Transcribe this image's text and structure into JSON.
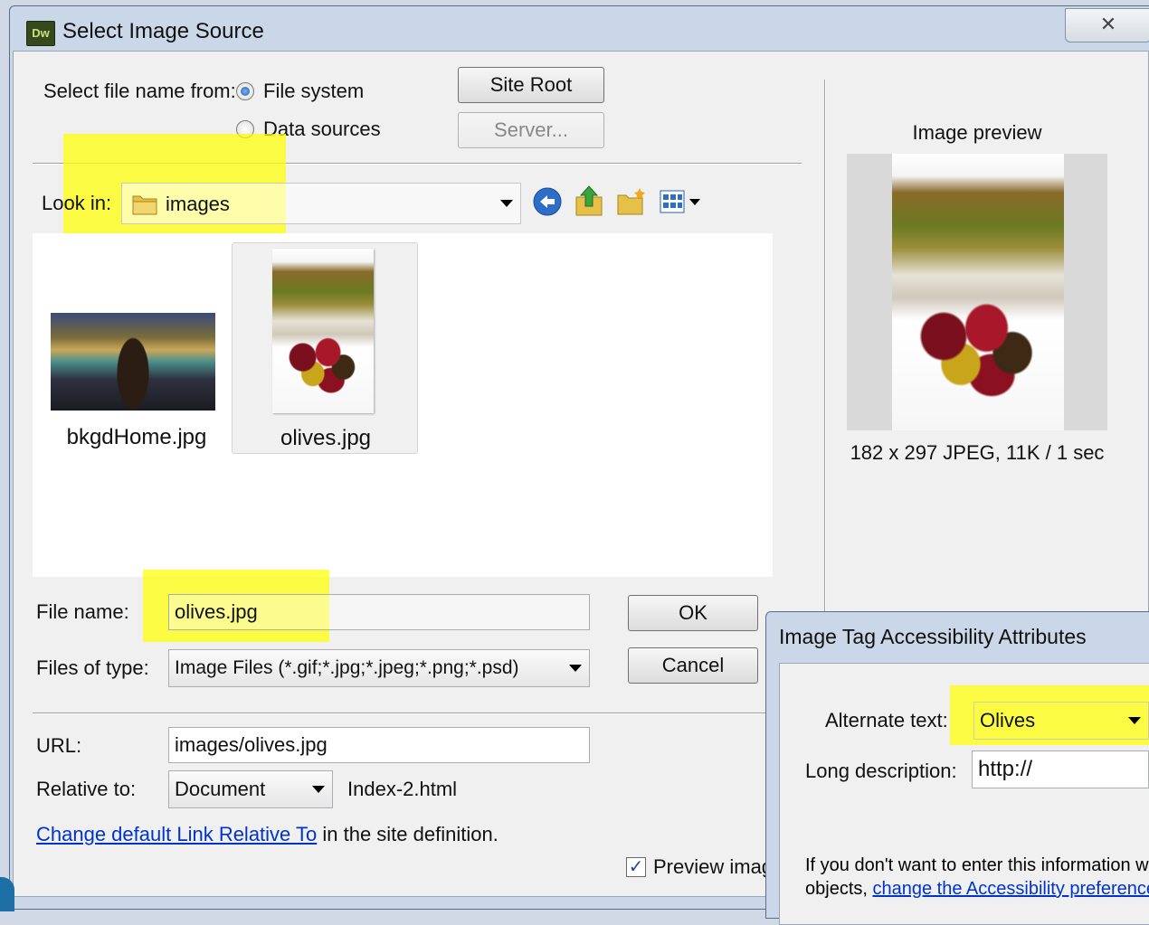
{
  "main_dialog": {
    "title": "Select Image Source",
    "app_icon_text": "Dw",
    "close_glyph": "✕",
    "select_from_label": "Select file name from:",
    "radio_file_system": "File system",
    "radio_data_sources": "Data sources",
    "site_root_button": "Site Root",
    "server_button": "Server...",
    "look_in_label": "Look in:",
    "look_in_value": "images",
    "files": [
      {
        "name": "bkgdHome.jpg",
        "selected": false
      },
      {
        "name": "olives.jpg",
        "selected": true
      }
    ],
    "file_name_label": "File name:",
    "file_name_value": "olives.jpg",
    "files_of_type_label": "Files of type:",
    "files_of_type_value": "Image Files (*.gif;*.jpg;*.jpeg;*.png;*.psd)",
    "ok_button": "OK",
    "cancel_button": "Cancel",
    "url_label": "URL:",
    "url_value": "images/olives.jpg",
    "relative_to_label": "Relative to:",
    "relative_to_value": "Document",
    "relative_file": "Index-2.html",
    "change_link_text": "Change default Link Relative To",
    "change_link_suffix": " in the site definition.",
    "preview_checkbox_label": "Preview images",
    "image_preview_label": "Image preview",
    "image_info": "182 x 297 JPEG, 11K / 1 sec"
  },
  "accessibility_dialog": {
    "title": "Image Tag Accessibility Attributes",
    "alt_text_label": "Alternate text:",
    "alt_text_value": "Olives",
    "long_desc_label": "Long description:",
    "long_desc_value": "http://",
    "note_line1": "If you don't want to enter this information when inserting",
    "note_line2_prefix": "objects, ",
    "note_link": "change the Accessibility preferences"
  },
  "colors": {
    "highlight": "#ffff00",
    "link": "#0033cc",
    "title_bar": "#c9d7e8"
  }
}
